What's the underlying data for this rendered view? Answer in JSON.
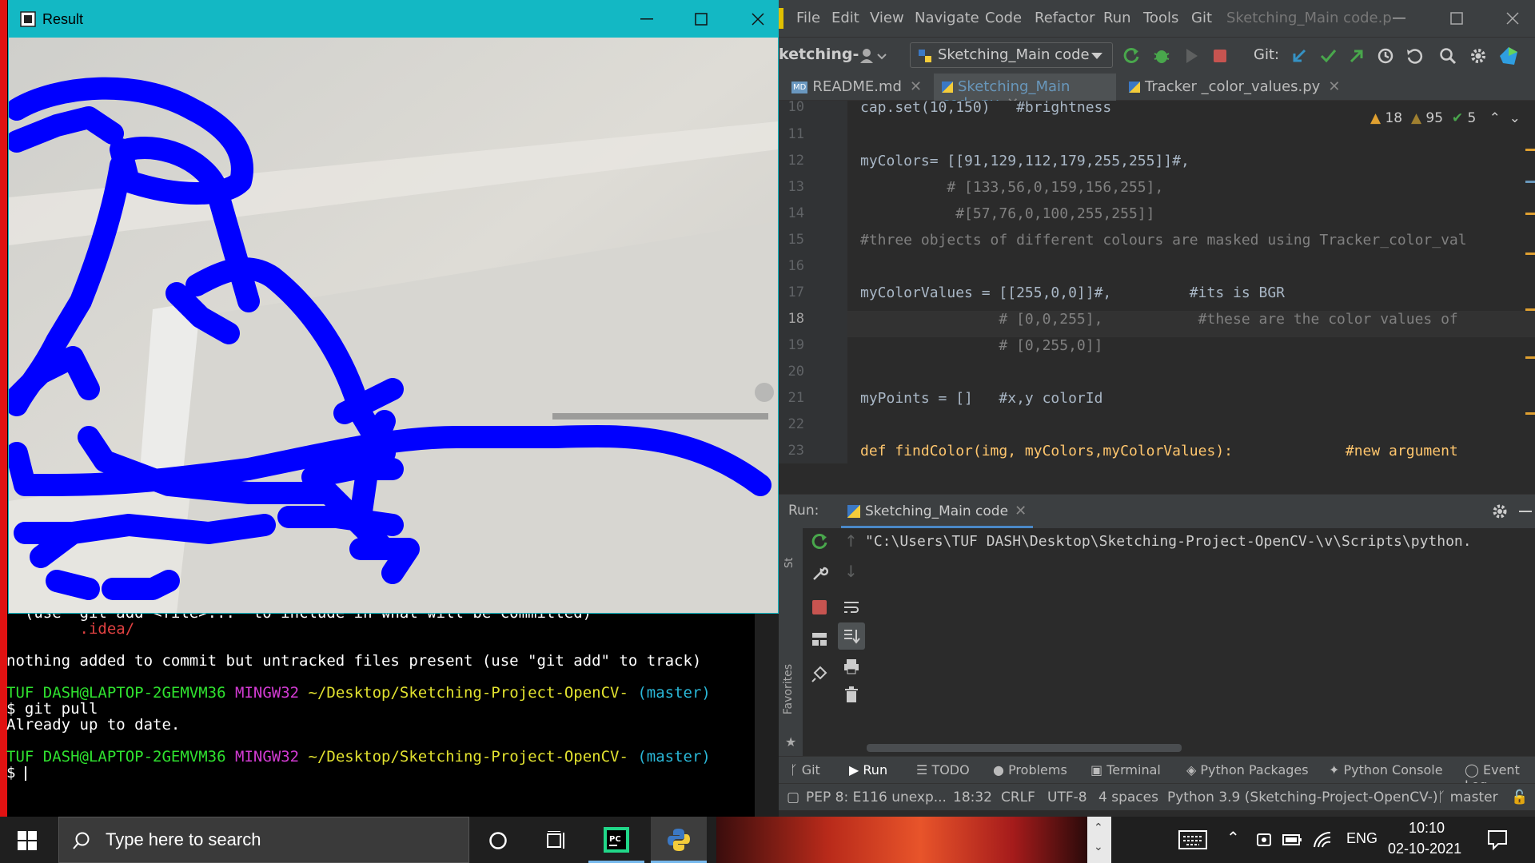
{
  "result_window": {
    "title": "Result"
  },
  "terminal": {
    "partial_line": "  (use \"git add <file>...\" to include in what will be committed)",
    "idea_dir": "        .idea/",
    "nothing_added": "nothing added to commit but untracked files present (use \"git add\" to track)",
    "prompt1": {
      "user": "TUF DASH@LAPTOP-2GEMVM36",
      "shell": "MINGW32",
      "path": "~/Desktop/Sketching-Project-OpenCV-",
      "branch": "(master)"
    },
    "cmd1": "$ git pull",
    "out1": "Already up to date.",
    "prompt2": {
      "user": "TUF DASH@LAPTOP-2GEMVM36",
      "shell": "MINGW32",
      "path": "~/Desktop/Sketching-Project-OpenCV-",
      "branch": "(master)"
    },
    "cmd2": "$ "
  },
  "ide": {
    "menu": [
      "File",
      "Edit",
      "View",
      "Navigate",
      "Code",
      "Refactor",
      "Run",
      "Tools",
      "Git"
    ],
    "window_title": "Sketching_Main code.p",
    "project_name": "ketching-",
    "run_config": "Sketching_Main code",
    "git_label": "Git:",
    "tabs": [
      "README.md",
      "Sketching_Main code.py",
      "Tracker _color_values.py"
    ],
    "inspections": {
      "warnings": "18",
      "weak_warnings": "95",
      "ok": "5"
    },
    "line_numbers": [
      "10",
      "11",
      "12",
      "13",
      "14",
      "15",
      "16",
      "17",
      "18",
      "19",
      "20",
      "21",
      "22",
      "23"
    ],
    "code_lines": [
      "cap.set(10,150)   #brightness",
      "",
      "myColors= [[91,129,112,179,255,255]]#,",
      "          # [133,56,0,159,156,255],",
      "           #[57,76,0,100,255,255]]",
      "#three objects of different colours are masked using Tracker_color_val",
      "",
      "myColorValues = [[255,0,0]]#,         #its is BGR",
      "                # [0,0,255],           #these are the color values of",
      "                # [0,255,0]]",
      "",
      "myPoints = []   #x,y colorId",
      "",
      "def findColor(img, myColors,myColorValues):             #new argument"
    ],
    "run": {
      "label": "Run:",
      "tab": "Sketching_Main code",
      "output": "\"C:\\Users\\TUF DASH\\Desktop\\Sketching-Project-OpenCV-\\v\\Scripts\\python."
    },
    "side_labels": {
      "structure": "St",
      "favorites": "Favorites"
    },
    "bottom_tabs": [
      "Git",
      "Run",
      "TODO",
      "Problems",
      "Terminal",
      "Python Packages",
      "Python Console",
      "Event Log"
    ],
    "status": {
      "message": "PEP 8: E116 unexp...",
      "position": "18:32",
      "line_sep": "CRLF",
      "encoding": "UTF-8",
      "indent": "4 spaces",
      "interpreter": "Python 3.9 (Sketching-Project-OpenCV-)",
      "branch": "master"
    }
  },
  "taskbar": {
    "search_placeholder": "Type here to search",
    "language": "ENG",
    "time": "10:10",
    "date": "02-10-2021"
  },
  "colors": {
    "terminal_bg": "#000000",
    "result_titlebar": "#13b8c4",
    "sketch_stroke": "#0000ff",
    "ide_bg": "#2b2b2b",
    "taskbar_bg": "#1f1f1f"
  }
}
